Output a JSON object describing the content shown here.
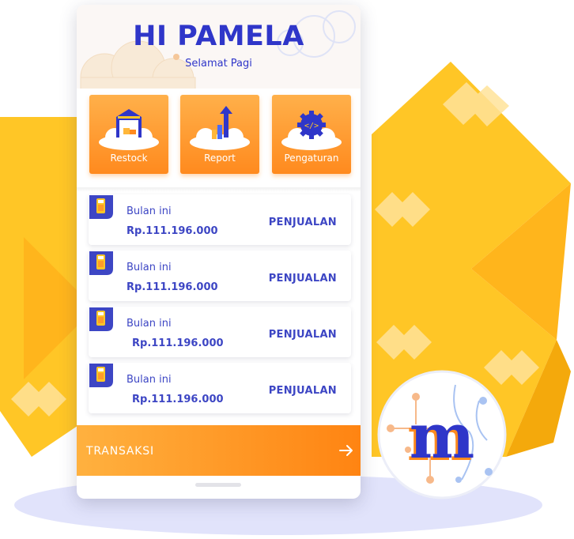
{
  "header": {
    "greeting": "HI PAMELA",
    "subgreeting": "Selamat Pagi"
  },
  "menu": [
    {
      "label": "Restock",
      "icon": "warehouse-icon"
    },
    {
      "label": "Report",
      "icon": "chart-up-icon"
    },
    {
      "label": "Pengaturan",
      "icon": "gear-icon"
    }
  ],
  "cards": [
    {
      "label": "Bulan ini",
      "amount": "Rp.111.196.000",
      "type": "PENJUALAN",
      "icon": "pos-terminal-icon"
    },
    {
      "label": "Bulan ini",
      "amount": "Rp.111.196.000",
      "type": "PENJUALAN",
      "icon": "pos-terminal-icon"
    },
    {
      "label": "Bulan ini",
      "amount": "Rp.111.196.000",
      "type": "PENJUALAN",
      "icon": "pos-terminal-icon"
    },
    {
      "label": "Bulan ini",
      "amount": "Rp.111.196.000",
      "type": "PENJUALAN",
      "icon": "pos-terminal-icon"
    }
  ],
  "transaction_button": {
    "label": "TRANSAKSI",
    "icon": "arrow-right-icon"
  },
  "brand": {
    "logo_letter": "m",
    "logo_icon": "brand-logo"
  },
  "colors": {
    "primary_blue": "#2f36c9",
    "accent_orange": "#ff8a1e",
    "background_yellow": "#ffc626",
    "floor_lavender": "#e1e3fb"
  }
}
